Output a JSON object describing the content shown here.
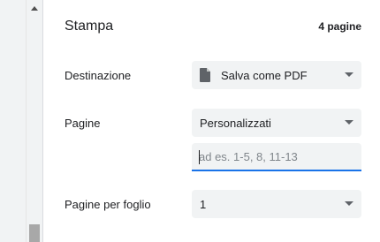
{
  "header": {
    "title": "Stampa",
    "sheet_count": "4 pagine"
  },
  "destination": {
    "label": "Destinazione",
    "value": "Salva come PDF",
    "icon": "document-icon"
  },
  "pages": {
    "label": "Pagine",
    "value": "Personalizzati",
    "custom_placeholder": "ad es. 1-5, 8, 11-13",
    "custom_value": ""
  },
  "pages_per_sheet": {
    "label": "Pagine per foglio",
    "value": "1"
  },
  "colors": {
    "accent": "#1a73e8",
    "field_bg": "#f1f3f4"
  }
}
